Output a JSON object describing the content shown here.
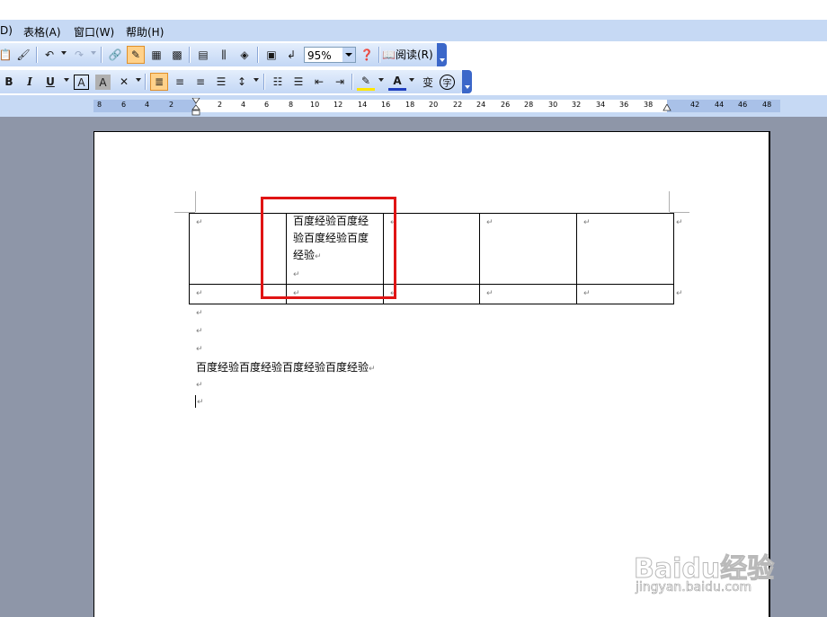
{
  "menu": {
    "items": [
      {
        "label": "D)"
      },
      {
        "label": "表格(A)"
      },
      {
        "label": "窗口(W)"
      },
      {
        "label": "帮助(H)"
      }
    ]
  },
  "toolbar": {
    "zoom_value": "95%",
    "read_label": "阅读(R)",
    "font_button_labels": {
      "bold": "B",
      "italic": "I",
      "underline": "U",
      "char_border": "A",
      "char_shade": "A",
      "font_color": "A",
      "phonetic": "变",
      "enclose": "字"
    }
  },
  "ruler": {
    "left_ticks": [
      "8",
      "6",
      "4",
      "2"
    ],
    "right_ticks": [
      "2",
      "4",
      "6",
      "8",
      "10",
      "12",
      "14",
      "16",
      "18",
      "20",
      "22",
      "24",
      "26",
      "28",
      "30",
      "32",
      "34",
      "36",
      "38",
      "42",
      "44",
      "46",
      "48"
    ]
  },
  "document": {
    "cell_text_lines": [
      "百度经验百度经",
      "验百度经验百度",
      "经验"
    ],
    "body_text": "百度经验百度经验百度经验百度经验",
    "para_mark": "↵"
  },
  "watermark": {
    "logo": "Baidu经验",
    "url": "jingyan.baidu.com"
  },
  "colors": {
    "highlight_box": "#e01414",
    "menubar": "#c6d9f4",
    "workspace": "#8e96a8"
  }
}
